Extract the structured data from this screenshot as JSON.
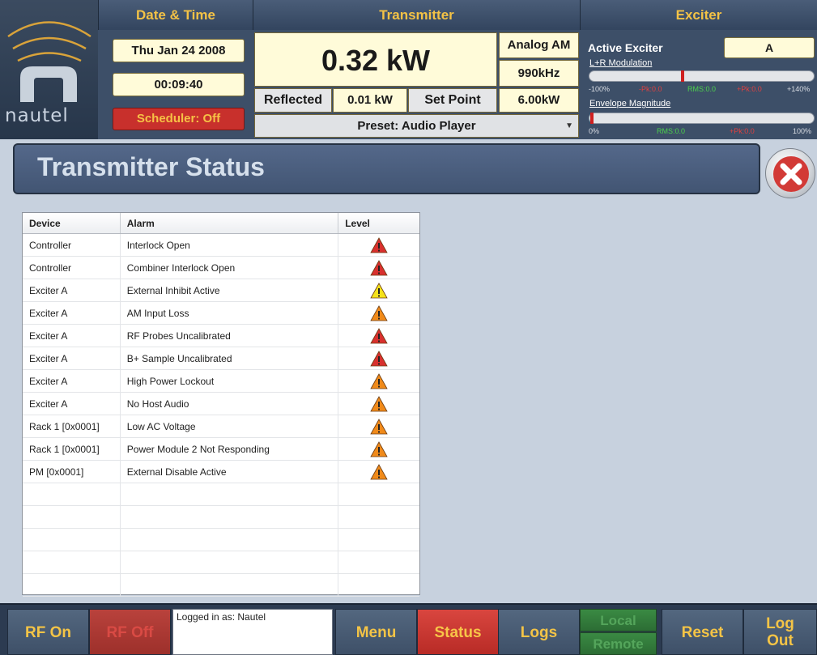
{
  "brand": "nautel",
  "datetime": {
    "header": "Date & Time",
    "date": "Thu Jan 24 2008",
    "time": "00:09:40",
    "scheduler": "Scheduler: Off"
  },
  "transmitter": {
    "header": "Transmitter",
    "power": "0.32 kW",
    "mode": "Analog AM",
    "frequency": "990kHz",
    "reflected_label": "Reflected",
    "reflected_value": "0.01 kW",
    "setpoint_label": "Set Point",
    "setpoint_value": "6.00kW",
    "preset": "Preset: Audio Player"
  },
  "exciter": {
    "header": "Exciter",
    "active_label": "Active Exciter",
    "active_value": "A",
    "lr_label": "L+R Modulation",
    "lr_scale": {
      "min": "-100%",
      "npk": "-Pk:0.0",
      "rms": "RMS:0.0",
      "ppk": "+Pk:0.0",
      "max": "+140%"
    },
    "env_label": "Envelope Magnitude",
    "env_scale": {
      "min": "0%",
      "rms": "RMS:0.0",
      "ppk": "+Pk:0.0",
      "max": "100%"
    }
  },
  "page": {
    "title": "Transmitter Status"
  },
  "alarms": {
    "columns": [
      "Device",
      "Alarm",
      "Level"
    ],
    "rows": [
      {
        "device": "Controller",
        "alarm": "Interlock Open",
        "level": "red"
      },
      {
        "device": "Controller",
        "alarm": "Combiner Interlock Open",
        "level": "red"
      },
      {
        "device": "Exciter A",
        "alarm": "External Inhibit Active",
        "level": "yellow"
      },
      {
        "device": "Exciter A",
        "alarm": "AM Input Loss",
        "level": "orange"
      },
      {
        "device": "Exciter A",
        "alarm": "RF Probes Uncalibrated",
        "level": "red"
      },
      {
        "device": "Exciter A",
        "alarm": "B+ Sample Uncalibrated",
        "level": "red"
      },
      {
        "device": "Exciter A",
        "alarm": "High Power Lockout",
        "level": "orange"
      },
      {
        "device": "Exciter A",
        "alarm": "No Host Audio",
        "level": "orange"
      },
      {
        "device": "Rack 1 [0x0001]",
        "alarm": "Low AC Voltage",
        "level": "orange"
      },
      {
        "device": "Rack 1 [0x0001]",
        "alarm": "Power Module 2 Not Responding",
        "level": "orange"
      },
      {
        "device": "PM [0x0001]",
        "alarm": "External Disable Active",
        "level": "orange"
      }
    ]
  },
  "level_colors": {
    "red": "#d8302e",
    "orange": "#f08a1a",
    "yellow": "#f5e21a"
  },
  "footer": {
    "rf_on": "RF On",
    "rf_off": "RF Off",
    "logged_in": "Logged in as: Nautel",
    "menu": "Menu",
    "status": "Status",
    "logs": "Logs",
    "local": "Local",
    "remote": "Remote",
    "reset": "Reset",
    "logout_line1": "Log",
    "logout_line2": "Out"
  }
}
